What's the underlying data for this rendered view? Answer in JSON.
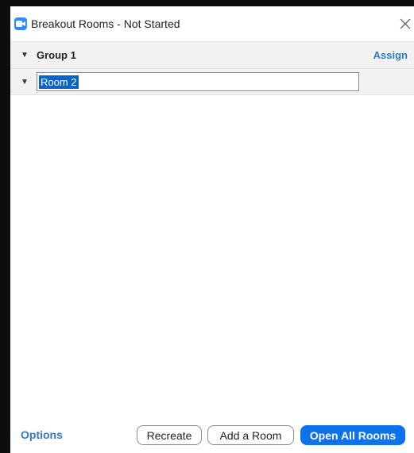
{
  "window": {
    "title": "Breakout Rooms - Not Started",
    "close_icon": "close-icon",
    "app_icon": "zoom-camera-icon"
  },
  "group": {
    "label": "Group 1",
    "assign_label": "Assign",
    "caret_icon": "caret-down-icon"
  },
  "room": {
    "name": "Room 2",
    "caret_icon": "caret-down-icon"
  },
  "footer": {
    "options_label": "Options",
    "recreate_label": "Recreate",
    "add_room_label": "Add a Room",
    "open_all_label": "Open All Rooms"
  },
  "colors": {
    "accent": "#0e72ed",
    "link": "#2d7ac7",
    "row_bg": "#f2f2f3"
  }
}
